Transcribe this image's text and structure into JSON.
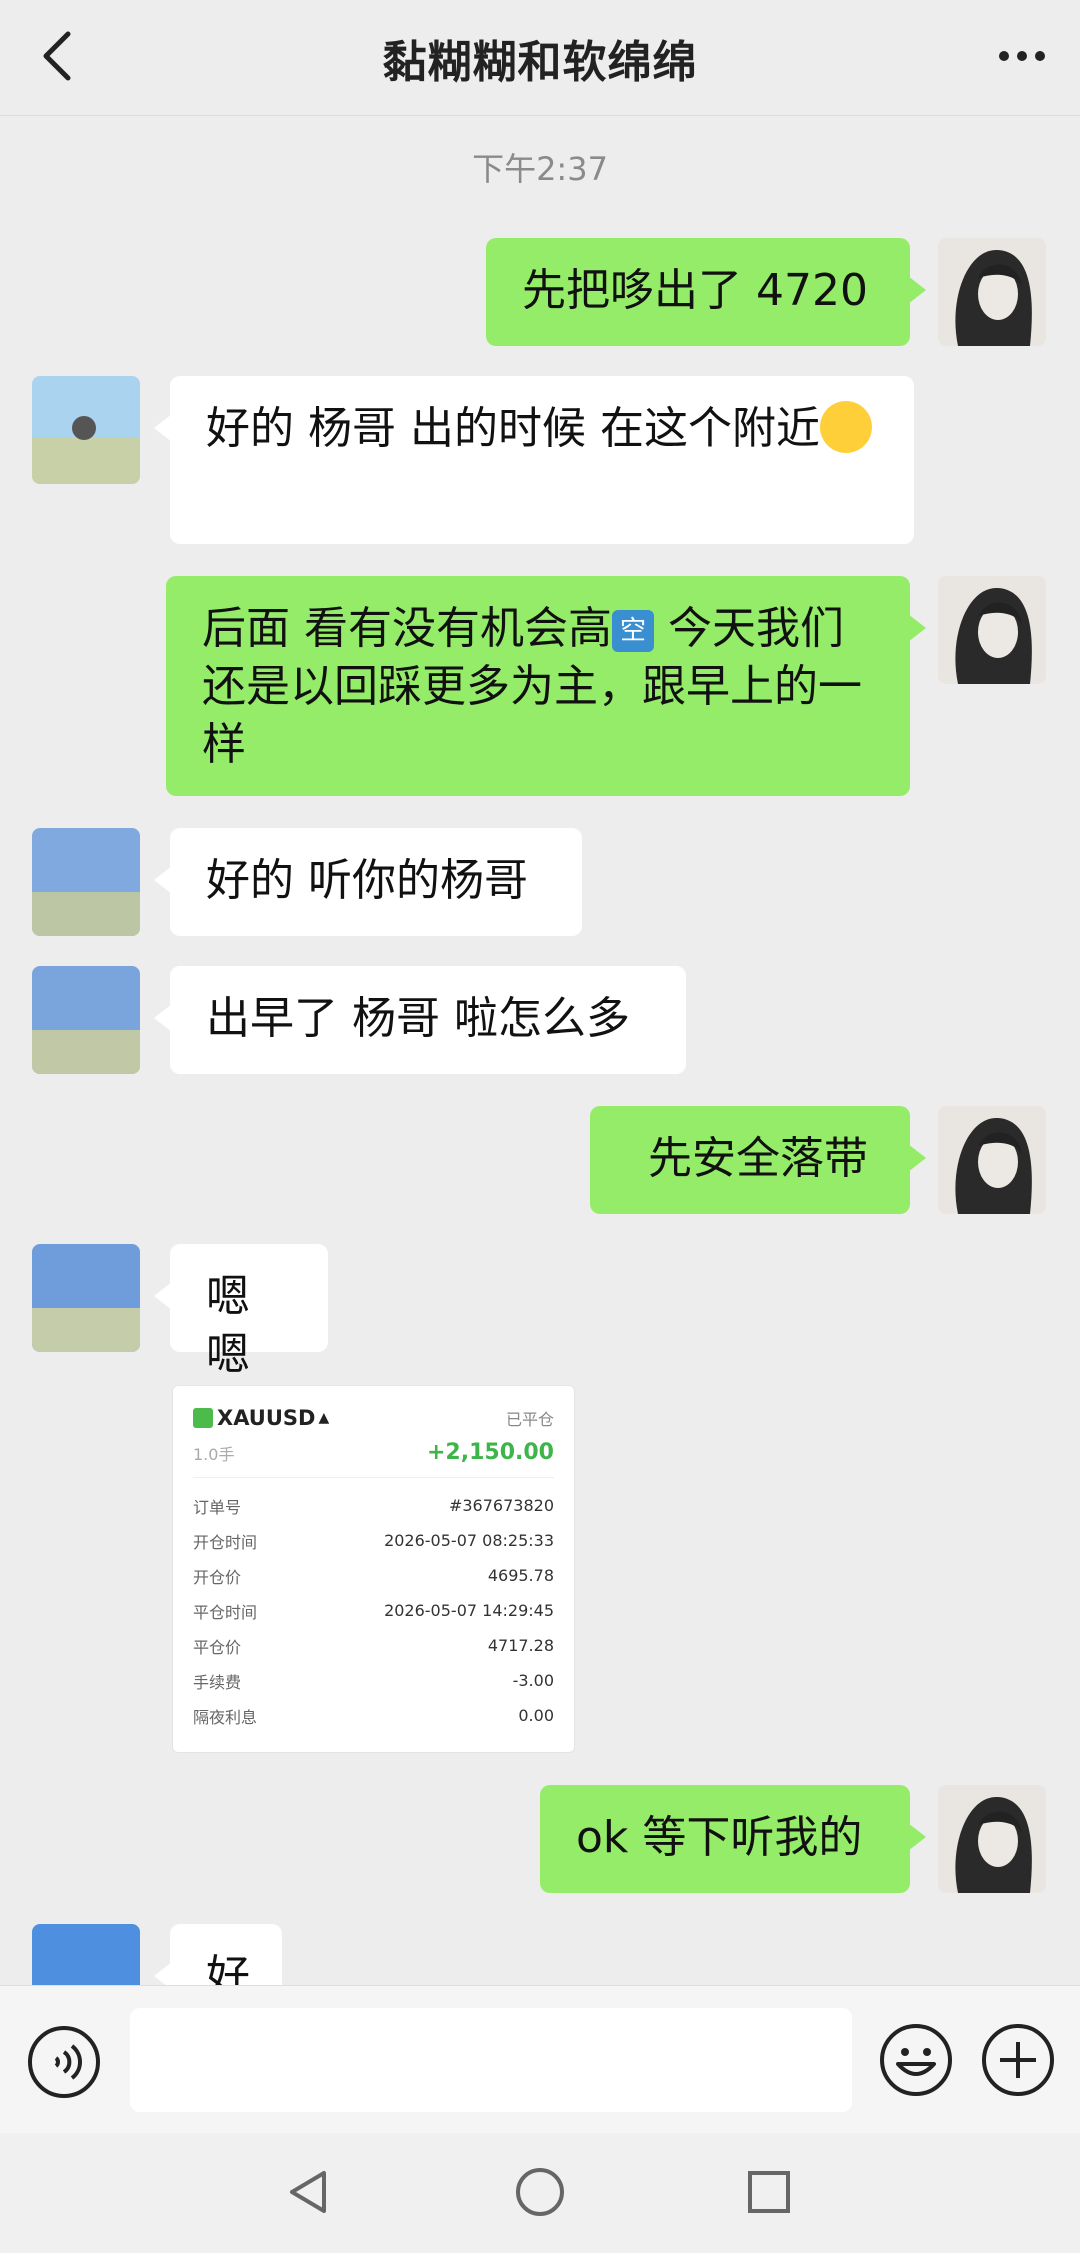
{
  "header": {
    "title": "黏糊糊和软绵绵"
  },
  "chat": {
    "timestamp": "下午2:37",
    "messages": [
      {
        "text": "先把哆出了 4720"
      },
      {
        "text": "好的 杨哥  出的时候 在这个附近"
      },
      {
        "text_a": "后面 看有没有机会高",
        "tag": "空",
        "text_b": " 今天我们还是以回踩更多为主，跟早上的一样"
      },
      {
        "text": "好的 听你的杨哥"
      },
      {
        "text": "出早了 杨哥 啦怎么多"
      },
      {
        "text": "先安全落带"
      },
      {
        "text": "嗯嗯"
      },
      {
        "text": "ok 等下听我的"
      },
      {
        "text": "好"
      }
    ]
  },
  "trade_card": {
    "symbol": "XAUUSD",
    "status": "已平仓",
    "lots": "1.0手",
    "pnl": "+2,150.00",
    "rows": [
      {
        "label": "订单号",
        "value": "#367673820"
      },
      {
        "label": "开仓时间",
        "value": "2026-05-07 08:25:33"
      },
      {
        "label": "开仓价",
        "value": "4695.78"
      },
      {
        "label": "平仓时间",
        "value": "2026-05-07 14:29:45"
      },
      {
        "label": "平仓价",
        "value": "4717.28"
      },
      {
        "label": "手续费",
        "value": "-3.00"
      },
      {
        "label": "隔夜利息",
        "value": "0.00"
      }
    ]
  },
  "input": {
    "value": "",
    "placeholder": ""
  },
  "icons": {
    "back": "chevron-left-icon",
    "more": "ellipsis-icon",
    "voice": "voice-icon",
    "emoji": "smiley-icon",
    "plus": "plus-icon",
    "nav_back": "triangle-back-icon",
    "nav_home": "circle-home-icon",
    "nav_recent": "square-recent-icon"
  },
  "colors": {
    "sent_bubble": "#95ec69",
    "recv_bubble": "#ffffff",
    "background": "#ededed",
    "profit": "#3db54a"
  }
}
